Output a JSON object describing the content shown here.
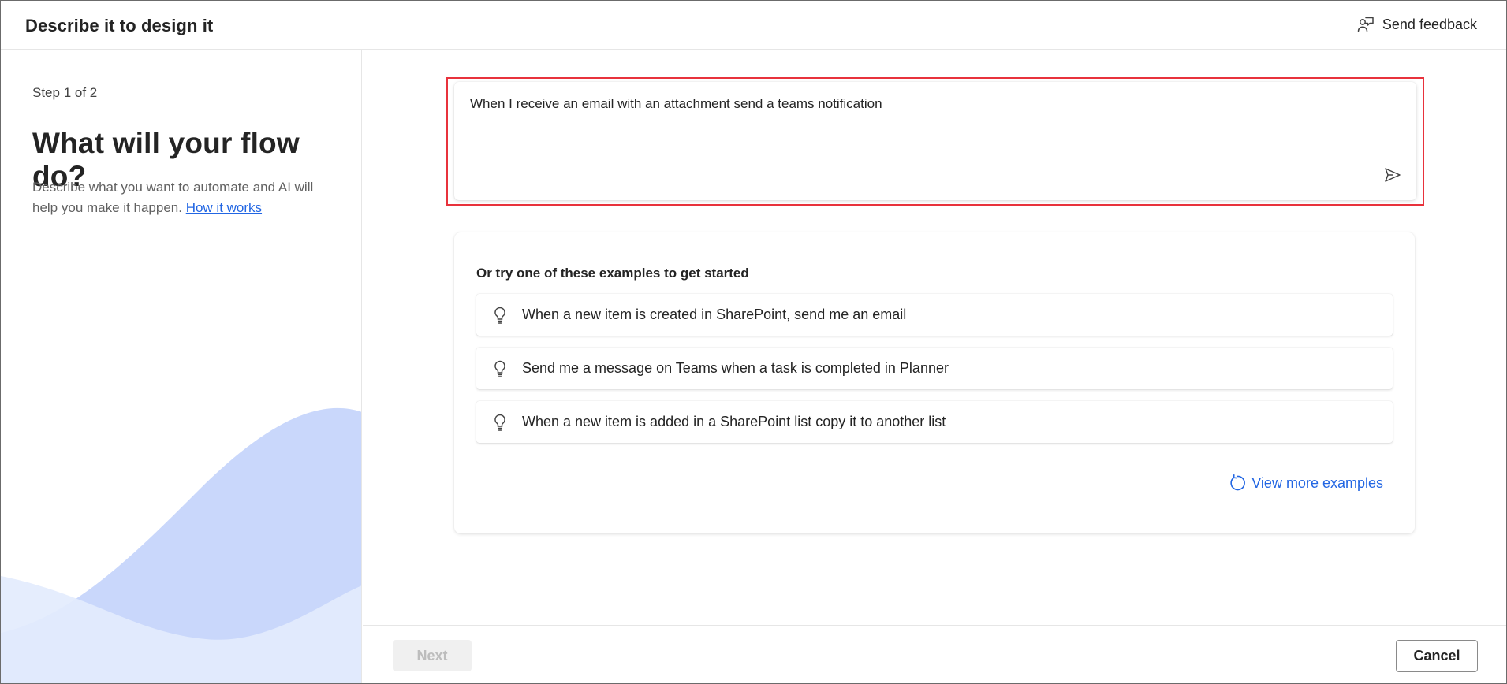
{
  "header": {
    "title": "Describe it to design it",
    "feedback_label": "Send feedback",
    "feedback_icon": "person-feedback-icon"
  },
  "left": {
    "step": "Step 1 of 2",
    "heading": "What will your flow do?",
    "description": "Describe what you want to automate and AI will help you make it happen.",
    "how_it_works": "How it works"
  },
  "prompt": {
    "value": "When I receive an email with an attachment send a teams notification",
    "send_icon": "send-icon",
    "highlight_color": "#e8323c"
  },
  "examples": {
    "title": "Or try one of these examples to get started",
    "items": [
      {
        "label": "When a new item is created in SharePoint, send me an email",
        "icon": "lightbulb-icon"
      },
      {
        "label": "Send me a message on Teams when a task is completed in Planner",
        "icon": "lightbulb-icon"
      },
      {
        "label": "When a new item is added in a SharePoint list copy it to another list",
        "icon": "lightbulb-icon"
      }
    ],
    "view_more": "View more examples",
    "view_more_icon": "refresh-icon"
  },
  "footer": {
    "next_label": "Next",
    "cancel_label": "Cancel"
  },
  "colors": {
    "accent": "#2266e3",
    "wave_back": "#c9d7fb",
    "wave_front": "#e3ebfd"
  }
}
